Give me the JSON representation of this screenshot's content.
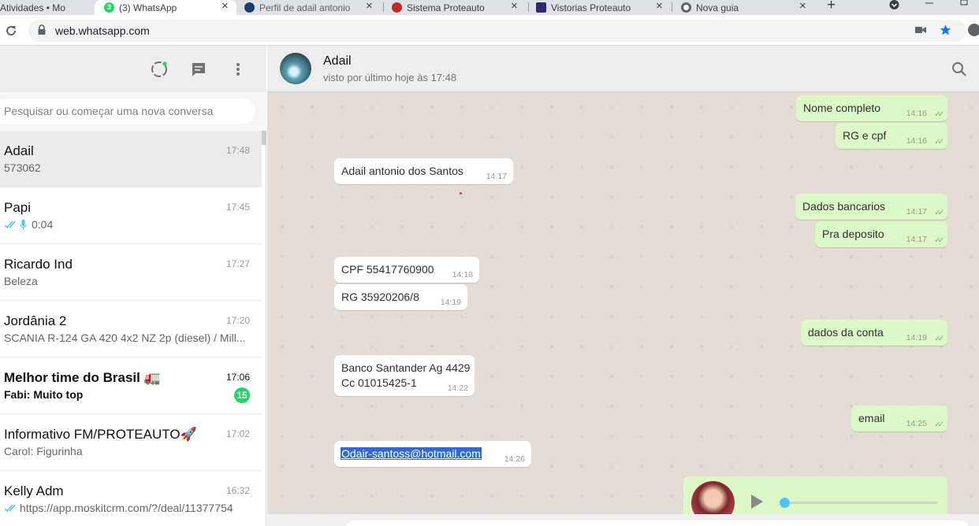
{
  "browser": {
    "tabs": [
      {
        "title": "Atividades • Mo"
      },
      {
        "title": "(3) WhatsApp",
        "badge": "3"
      },
      {
        "title": "Perfil de adail antonio"
      },
      {
        "title": "Sistema Proteauto"
      },
      {
        "title": "Vistorias Proteauto"
      },
      {
        "title": "Nova guia"
      }
    ],
    "new_tab": "+",
    "close": "×",
    "url": "web.whatsapp.com"
  },
  "sidebar": {
    "search_placeholder": "Pesquisar ou começar uma nova conversa",
    "chats": [
      {
        "name": "Adail",
        "time": "17:48",
        "preview": "573062"
      },
      {
        "name": "Papi",
        "time": "17:45",
        "preview": "0:04"
      },
      {
        "name": "Ricardo Ind",
        "time": "17:27",
        "preview": "Beleza"
      },
      {
        "name": "Jordânia 2",
        "time": "17:20",
        "preview": "SCANIA R-124 GA 420 4x2 NZ 2p (diesel) / Mill..."
      },
      {
        "name": "Melhor time do Brasil 🚛",
        "time": "17:06",
        "preview": "Fabi: Muito top",
        "unread": "15"
      },
      {
        "name": "Informativo FM/PROTEAUTO🚀",
        "time": "17:02",
        "preview": "Carol: Figurinha"
      },
      {
        "name": "Kelly Adm",
        "time": "16:32",
        "preview": "https://app.moskitcrm.com/?/deal/11377754"
      }
    ]
  },
  "conversation": {
    "contact_name": "Adail",
    "status": "visto por último hoje às 17:48",
    "messages": [
      {
        "dir": "out",
        "text": "Nome completo",
        "time": "14:16"
      },
      {
        "dir": "out",
        "text": "RG e cpf",
        "time": "14:16"
      },
      {
        "dir": "in",
        "text": "Adail antonio dos Santos",
        "time": "14:17"
      },
      {
        "dir": "out",
        "text": "Dados bancarios",
        "time": "14:17"
      },
      {
        "dir": "out",
        "text": "Pra deposito",
        "time": "14:17"
      },
      {
        "dir": "in",
        "text": "CPF 55417760900",
        "time": "14:18"
      },
      {
        "dir": "in",
        "text": "RG 35920206/8",
        "time": "14:19"
      },
      {
        "dir": "out",
        "text": "dados da conta",
        "time": "14:19"
      },
      {
        "dir": "in",
        "text": "Banco Santander Ag 4429",
        "text2": "Cc 01015425-1",
        "time": "14:22"
      },
      {
        "dir": "out",
        "text": "email",
        "time": "14:25"
      },
      {
        "dir": "in",
        "text": "Odair-santoss@hotmail.com",
        "time": "14:26"
      }
    ],
    "voice_progress": 0.0
  },
  "colors": {
    "accent_green": "#25d366",
    "outgoing_bubble": "#dcf8c6",
    "wallpaper": "#e5ddd5",
    "tick_blue": "#4fc3f7"
  }
}
